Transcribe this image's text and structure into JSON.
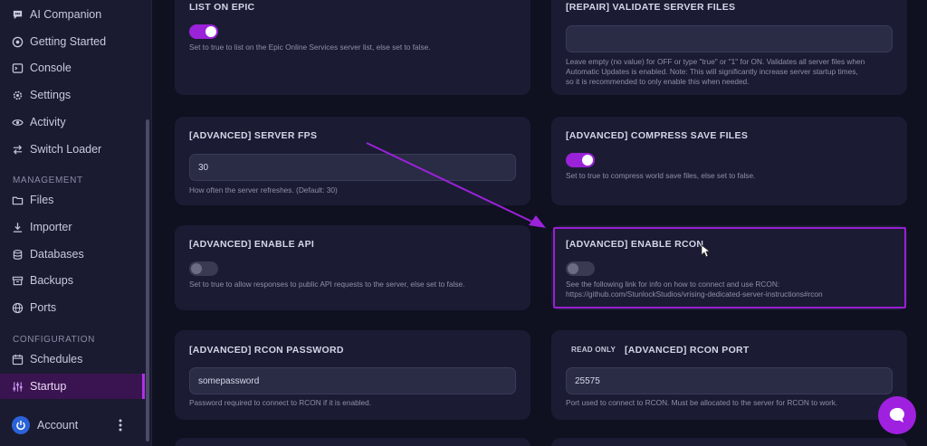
{
  "sidebar": {
    "items": [
      {
        "label": "AI Companion",
        "icon": "chat-icon"
      },
      {
        "label": "Getting Started",
        "icon": "compass-icon"
      },
      {
        "label": "Console",
        "icon": "terminal-icon"
      },
      {
        "label": "Settings",
        "icon": "gear-icon"
      },
      {
        "label": "Activity",
        "icon": "eye-icon"
      },
      {
        "label": "Switch Loader",
        "icon": "swap-icon"
      }
    ],
    "management_label": "MANAGEMENT",
    "management": [
      {
        "label": "Files",
        "icon": "folder-icon"
      },
      {
        "label": "Importer",
        "icon": "download-icon"
      },
      {
        "label": "Databases",
        "icon": "database-icon"
      },
      {
        "label": "Backups",
        "icon": "archive-icon"
      },
      {
        "label": "Ports",
        "icon": "globe-icon"
      }
    ],
    "configuration_label": "CONFIGURATION",
    "configuration": [
      {
        "label": "Schedules",
        "icon": "calendar-icon"
      },
      {
        "label": "Startup",
        "icon": "sliders-icon",
        "active": true
      }
    ],
    "account_label": "Account"
  },
  "cards": {
    "list_on_epic": {
      "title": "LIST ON EPIC",
      "enabled": true,
      "description": "Set to true to list on the Epic Online Services server list, else set to false."
    },
    "validate_files": {
      "title": "[REPAIR] VALIDATE SERVER FILES",
      "value": "",
      "description_lines": [
        "Leave empty (no value) for OFF or type \"true\" or \"1\" for ON. Validates all server files when",
        "Automatic Updates is enabled. Note: This will significantly increase server startup times,",
        "so it is recommended to only enable this when needed."
      ]
    },
    "server_fps": {
      "title": "[ADVANCED] SERVER FPS",
      "value": "30",
      "description": "How often the server refreshes. (Default: 30)"
    },
    "compress_save": {
      "title": "[ADVANCED] COMPRESS SAVE FILES",
      "enabled": true,
      "description": "Set to true to compress world save files, else set to false."
    },
    "enable_api": {
      "title": "[ADVANCED] ENABLE API",
      "enabled": false,
      "description": "Set to true to allow responses to public API requests to the server, else set to false."
    },
    "enable_rcon": {
      "title": "[ADVANCED] ENABLE RCON",
      "enabled": false,
      "description_lines": [
        "See the following link for info on how to connect and use RCON:",
        "https://github.com/StunlockStudios/vrising-dedicated-server-instructions#rcon"
      ]
    },
    "rcon_password": {
      "title": "[ADVANCED] RCON PASSWORD",
      "value": "somepassword",
      "description": "Password required to connect to RCON if it is enabled."
    },
    "rcon_port": {
      "badge": "READ ONLY",
      "title": "[ADVANCED] RCON PORT",
      "value": "25575",
      "description": "Port used to connect to RCON. Must be allocated to the server for RCON to work."
    }
  },
  "colors": {
    "accent": "#9a22d8",
    "highlight_border": "#9a1fd3",
    "annotation_arrow": "#9b22d9",
    "background": "#0f1020",
    "card": "#1b1c33"
  }
}
